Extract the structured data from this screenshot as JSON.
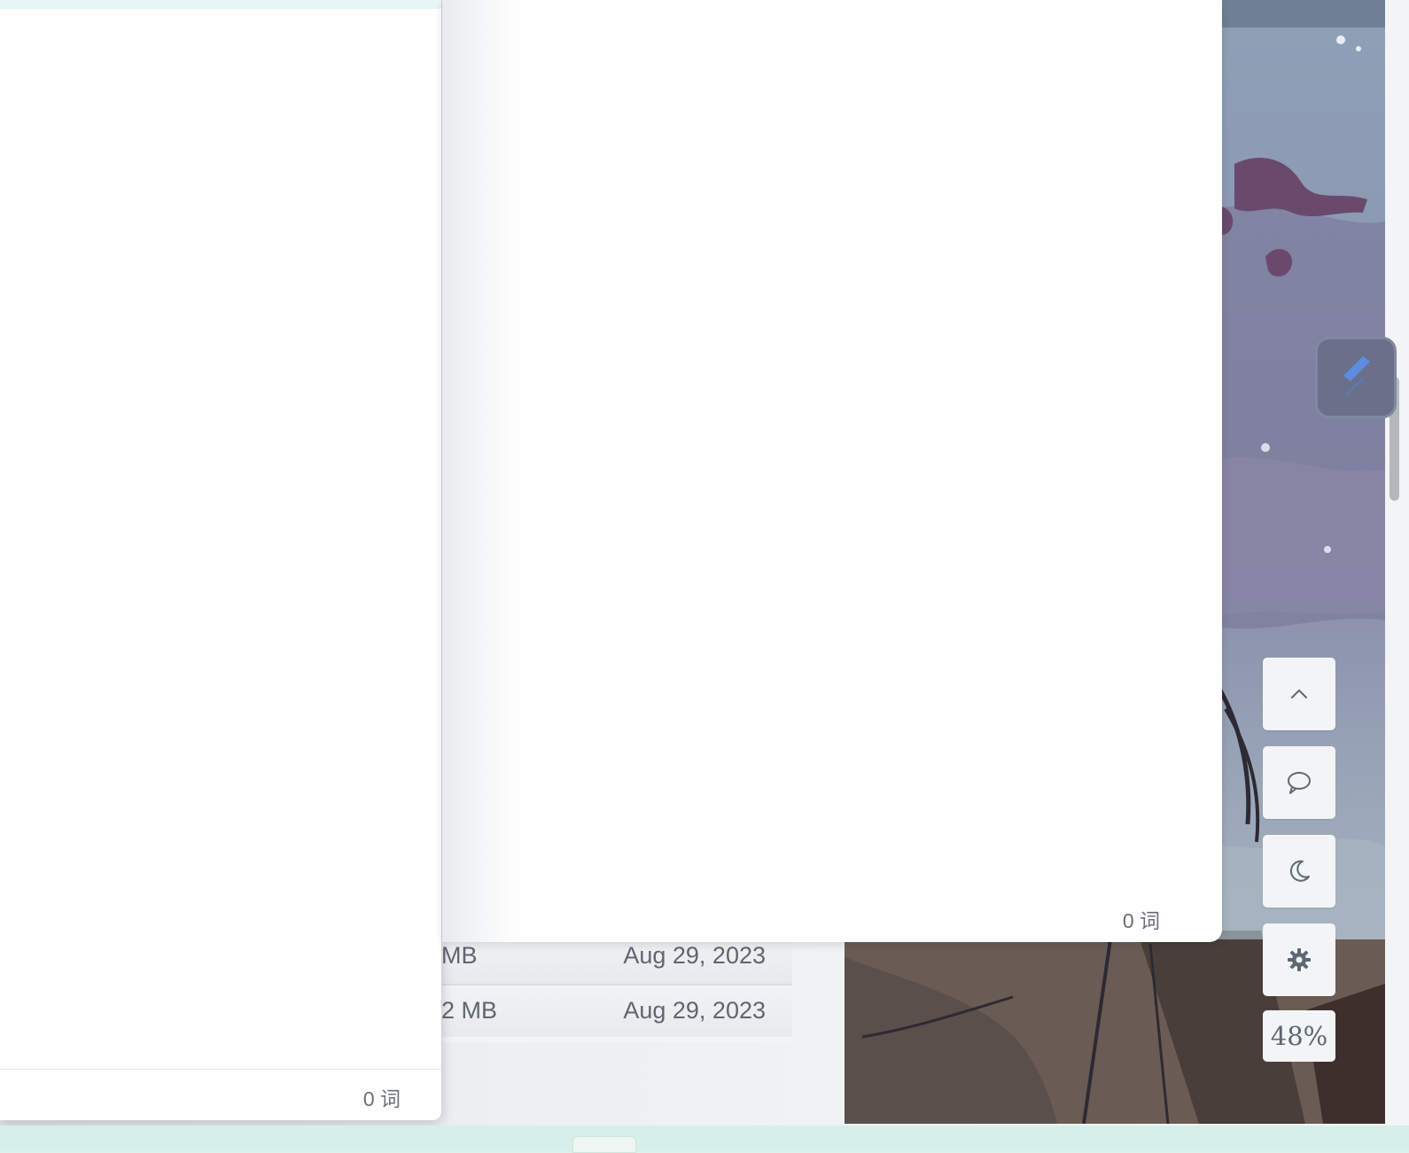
{
  "file_list": {
    "rows": [
      {
        "size": "MB",
        "date": "Aug 29, 2023"
      },
      {
        "size": "2 MB",
        "date": "Aug 29, 2023"
      }
    ]
  },
  "editor_left": {
    "word_count": "0 词"
  },
  "editor_main": {
    "word_count": "0 词"
  },
  "toolbar": {
    "zoom": "48%",
    "buttons": [
      {
        "icon": "chevron-up-icon"
      },
      {
        "icon": "comment-icon"
      },
      {
        "icon": "moon-icon"
      },
      {
        "icon": "gear-icon"
      }
    ]
  },
  "app_badge": {
    "icon": "app-logo-icon"
  },
  "colors": {
    "accent": "#4d7fd6",
    "toolbar_icon": "#5c6873",
    "taskbar": "#d6efe8"
  }
}
